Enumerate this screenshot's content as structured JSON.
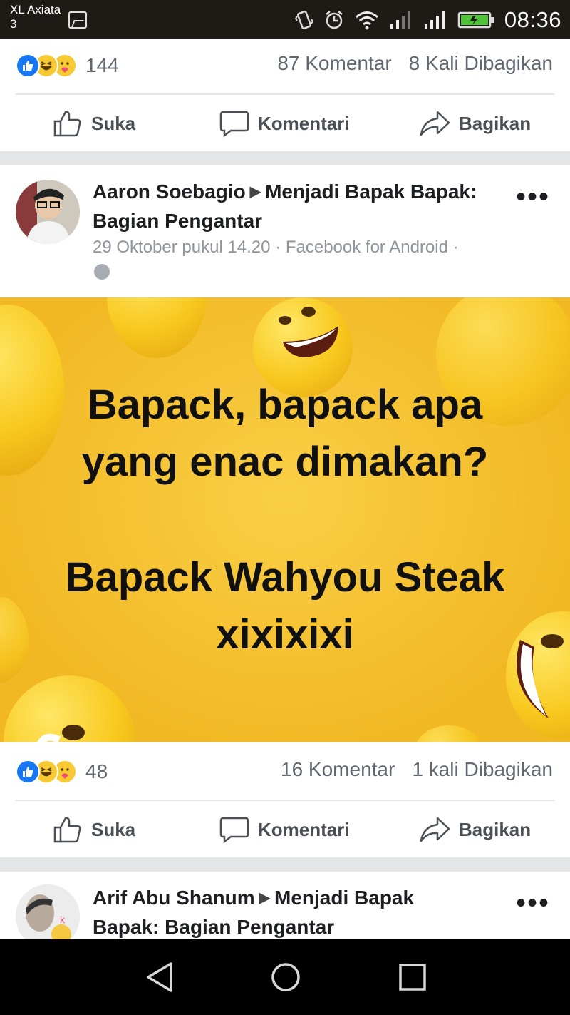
{
  "status_bar": {
    "carrier_line1": "XL Axiata",
    "carrier_line2": "3",
    "time": "08:36"
  },
  "post1": {
    "reaction_count": "144",
    "comments": "87 Komentar",
    "shares": "8 Kali Dibagikan"
  },
  "actions": {
    "like": "Suka",
    "comment": "Komentari",
    "share": "Bagikan"
  },
  "post2": {
    "author": "Aaron Soebagio",
    "group": "Menjadi Bapak Bapak: Bagian Pengantar",
    "meta": "29 Oktober pukul 14.20 · Facebook for Android ·",
    "image_line1": "Bapack, bapack apa",
    "image_line2": "yang enac dimakan?",
    "image_line3": "Bapack Wahyou Steak",
    "image_line4": "xixixixi",
    "reaction_count": "48",
    "comments": "16 Komentar",
    "shares": "1 kali Dibagikan"
  },
  "post3": {
    "author": "Arif Abu Shanum",
    "group_part1": "Menjadi Bapak",
    "group_part2": "Bapak: Bagian Pengantar"
  },
  "icons": [
    "gallery-icon",
    "vibrate-icon",
    "alarm-icon",
    "wifi-icon",
    "signal-icon",
    "battery-icon",
    "like-reaction-icon",
    "haha-reaction-icon",
    "care-reaction-icon",
    "like-icon",
    "comment-icon",
    "share-icon",
    "more-icon",
    "globe-icon",
    "back-icon",
    "home-icon",
    "recents-icon"
  ],
  "colors": {
    "like_blue": "#1877f2",
    "image_yellow": "#f3bd26",
    "status_bar": "#1e1b17"
  }
}
